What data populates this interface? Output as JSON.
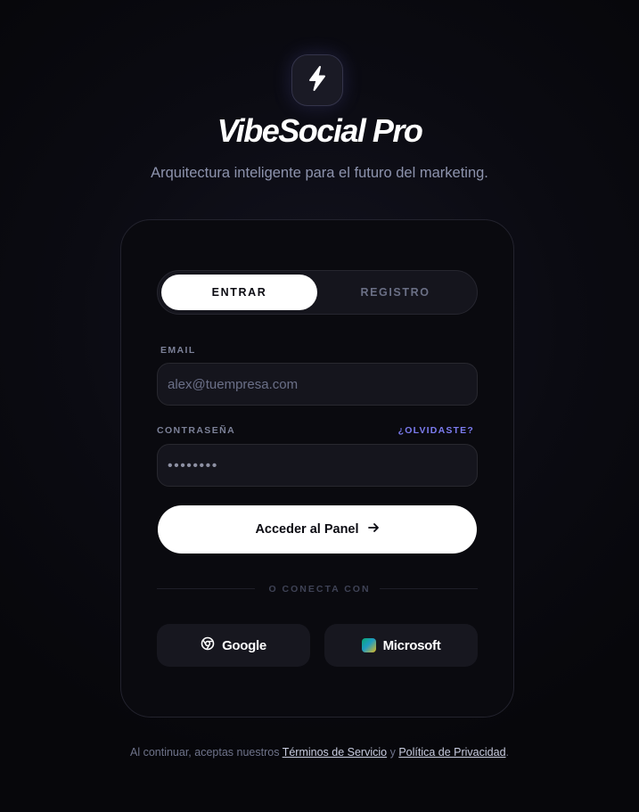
{
  "brand": {
    "name": "VibeSocial Pro",
    "tagline": "Arquitectura inteligente para el futuro del marketing.",
    "logo_icon": "lightning-bolt-icon"
  },
  "tabs": {
    "login": "ENTRAR",
    "register": "REGISTRO",
    "active": "login"
  },
  "form": {
    "email_label": "EMAIL",
    "email_placeholder": "alex@tuempresa.com",
    "password_label": "CONTRASEÑA",
    "password_placeholder": "••••••••",
    "forgot_link": "¿OLVIDASTE?",
    "submit_label": "Acceder al Panel"
  },
  "social": {
    "divider_text": "O CONECTA CON",
    "google_label": "Google",
    "microsoft_label": "Microsoft"
  },
  "footer": {
    "prefix": "Al continuar, aceptas nuestros ",
    "terms": "Términos de Servicio",
    "conjunction": " y ",
    "privacy": "Política de Privacidad",
    "suffix": "."
  },
  "colors": {
    "background": "#0b0b12",
    "card": "#0a0a0f",
    "accent_link": "#7c7cf0",
    "primary_button": "#ffffff"
  }
}
